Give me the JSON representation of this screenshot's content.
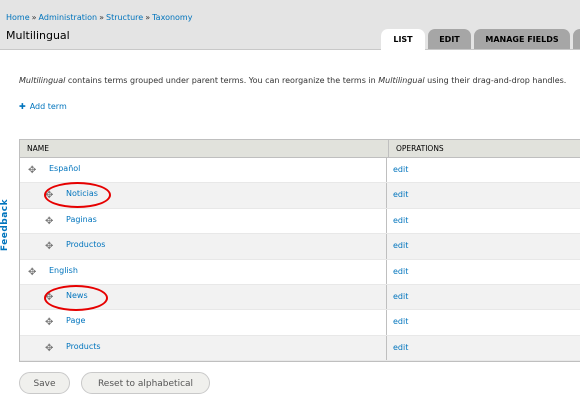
{
  "breadcrumb": [
    "Home",
    "Administration",
    "Structure",
    "Taxonomy"
  ],
  "breadcrumb_sep": "»",
  "page_title": "Multilingual",
  "tabs": [
    "LIST",
    "EDIT",
    "MANAGE FIELDS",
    ""
  ],
  "description": {
    "vocab": "Multilingual",
    "part1": " contains terms grouped under parent terms. You can reorganize the terms in ",
    "part2": " using their drag-and-drop handles."
  },
  "add_term_label": "Add term",
  "feedback_label": "Feedback",
  "table": {
    "headers": [
      "NAME",
      "OPERATIONS"
    ],
    "rows": [
      {
        "name": "Español",
        "op": "edit",
        "level": 0
      },
      {
        "name": "Noticias",
        "op": "edit",
        "level": 1
      },
      {
        "name": "Paginas",
        "op": "edit",
        "level": 1
      },
      {
        "name": "Productos",
        "op": "edit",
        "level": 1
      },
      {
        "name": "English",
        "op": "edit",
        "level": 0
      },
      {
        "name": "News",
        "op": "edit",
        "level": 1
      },
      {
        "name": "Page",
        "op": "edit",
        "level": 1
      },
      {
        "name": "Products",
        "op": "edit",
        "level": 1
      }
    ]
  },
  "buttons": {
    "save": "Save",
    "reset": "Reset to alphabetical"
  },
  "colors": {
    "link": "#0074bd",
    "annotation": "#e60000",
    "header_bg": "#e4e4e4"
  },
  "icons": {
    "drag_handle": "move-cross-icon",
    "add": "plus-icon"
  }
}
